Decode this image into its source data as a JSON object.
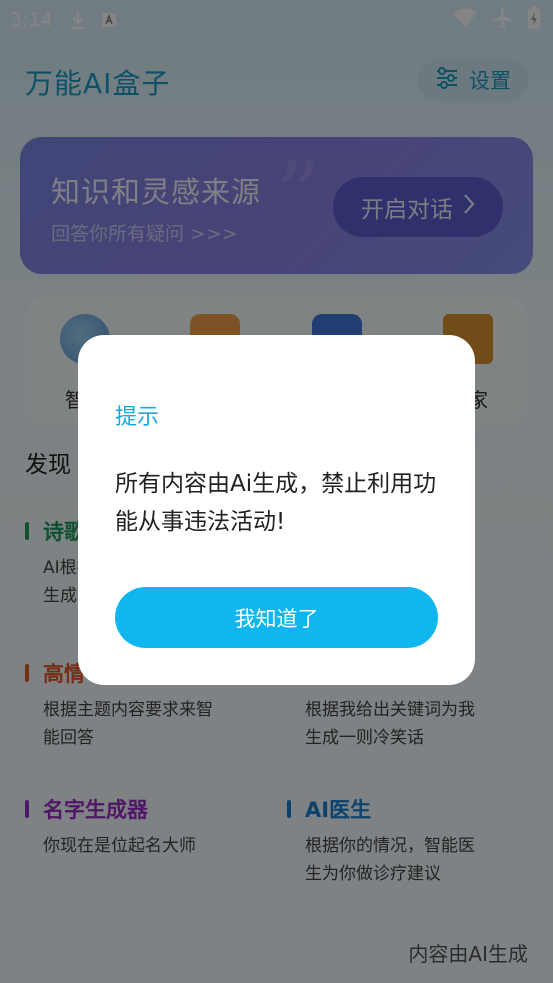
{
  "status_bar": {
    "time": "3:14"
  },
  "header": {
    "title": "万能AI盒子",
    "settings_label": "设置"
  },
  "banner": {
    "title": "知识和灵感来源",
    "subtitle": "回答你所有疑问 >>>",
    "button_label": "开启对话",
    "quote_mark": "”"
  },
  "tools": [
    {
      "label": "智能",
      "icon": "palette-icon",
      "color": "#7fb8e8"
    },
    {
      "label": "",
      "icon": "notebook-icon",
      "color": "#f0a04a"
    },
    {
      "label": "",
      "icon": "book-icon",
      "color": "#3f78d8"
    },
    {
      "label": "学家",
      "icon": "graduation-cap-icon",
      "color": "#d9902f"
    }
  ],
  "discover": {
    "title": "发现",
    "cards": [
      {
        "title": "诗歌",
        "desc": "AI根据\n生成",
        "color": "#1f9a5a"
      },
      {
        "title": "",
        "desc": "",
        "color": "#2c88d9"
      },
      {
        "title": "高情",
        "desc": "根据主题内容要求来智能回答",
        "color": "#e35b2c"
      },
      {
        "title": "",
        "desc": "根据我给出关键词为我生成一则冷笑话",
        "color": "#e0a030"
      },
      {
        "title": "名字生成器",
        "desc": "你现在是位起名大师",
        "color": "#9a2cc4"
      },
      {
        "title": "AI医生",
        "desc": "根据你的情况，智能医生为你做诊疗建议",
        "color": "#1a7fcf"
      }
    ]
  },
  "footer": {
    "note": "内容由AI生成"
  },
  "dialog": {
    "title": "提示",
    "message": "所有内容由Ai生成，禁止利用功能从事违法活动!",
    "button_label": "我知道了"
  }
}
